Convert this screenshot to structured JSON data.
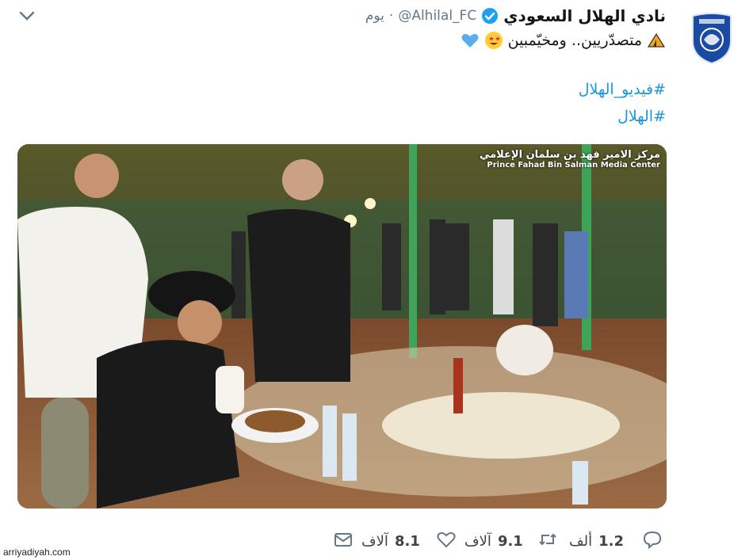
{
  "tweet": {
    "display_name": "نادي الهلال السعودي",
    "handle": "@Alhilal_FC",
    "separator": "·",
    "time": "يوم",
    "text": "متصدّريين.. ومخيّمبين",
    "icons": [
      "tent-icon",
      "star-struck-emoji-icon",
      "blue-heart-icon"
    ],
    "hashtags": [
      "#فيديو_الهلال",
      "#الهلال"
    ]
  },
  "media": {
    "watermark_ar": "مركز الامير فهد بن سلمان الإعلامي",
    "watermark_en": "Prince Fahad Bin Salman Media Center"
  },
  "actions": {
    "reply": {
      "count": "1.2",
      "unit": "ألف",
      "icon": "reply-icon"
    },
    "retweet": {
      "count": "9.1",
      "unit": "آلاف",
      "icon": "retweet-icon"
    },
    "like": {
      "count": "8.1",
      "unit": "آلاف",
      "icon": "heart-icon"
    },
    "share": {
      "icon": "envelope-icon"
    }
  },
  "credit": "arriyadiyah.com",
  "colors": {
    "link": "#1b95e0",
    "verified": "#1da1f2",
    "muted": "#657786",
    "club_blue": "#1b4aa3"
  }
}
